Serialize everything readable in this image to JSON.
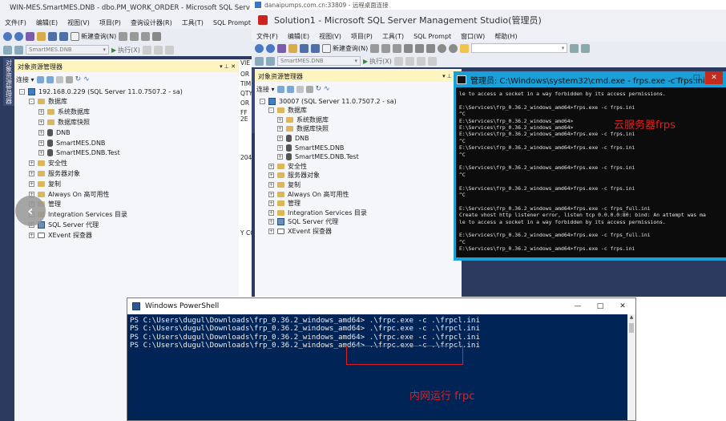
{
  "rdp_bar": {
    "title": "danaipumps.com.cn:33809 - 远程桌面连接"
  },
  "ssms_left": {
    "title": "WIN-MES.SmartMES.DNB - dbo.PM_WORK_ORDER - Microsoft SQL Server",
    "menu": [
      "文件(F)",
      "编辑(E)",
      "视图(V)",
      "项目(P)",
      "查询设计器(R)",
      "工具(T)",
      "SQL Prompt"
    ],
    "new_query": "新建查询(N)",
    "db_combo": "SmartMES.DNB",
    "execute": "执行(X)",
    "vertical_tab": "对象资源管理器",
    "explorer_title": "对象资源管理器",
    "connect": "连接",
    "tree": [
      {
        "label": "192.168.0.229 (SQL Server 11.0.7507.2 - sa)",
        "level": 0,
        "kind": "server",
        "exp": "-"
      },
      {
        "label": "数据库",
        "level": 1,
        "kind": "folder",
        "exp": "-"
      },
      {
        "label": "系统数据库",
        "level": 2,
        "kind": "folder",
        "exp": "+"
      },
      {
        "label": "数据库快照",
        "level": 2,
        "kind": "folder",
        "exp": "+"
      },
      {
        "label": "DNB",
        "level": 2,
        "kind": "db",
        "exp": "+"
      },
      {
        "label": "SmartMES.DNB",
        "level": 2,
        "kind": "db",
        "exp": "+"
      },
      {
        "label": "SmartMES.DNB.Test",
        "level": 2,
        "kind": "db",
        "exp": "+"
      },
      {
        "label": "安全性",
        "level": 1,
        "kind": "folder",
        "exp": "+"
      },
      {
        "label": "服务器对象",
        "level": 1,
        "kind": "folder",
        "exp": "+"
      },
      {
        "label": "复制",
        "level": 1,
        "kind": "folder",
        "exp": "+"
      },
      {
        "label": "Always On 高可用性",
        "level": 1,
        "kind": "folder",
        "exp": "+"
      },
      {
        "label": "管理",
        "level": 1,
        "kind": "folder",
        "exp": "+"
      },
      {
        "label": "Integration Services 目录",
        "level": 1,
        "kind": "folder",
        "exp": "+"
      },
      {
        "label": "SQL Server 代理",
        "level": 1,
        "kind": "agent",
        "exp": "+"
      },
      {
        "label": "XEvent 探查器",
        "level": 1,
        "kind": "xevent",
        "exp": "+"
      }
    ],
    "peek_text": [
      "VIE",
      "OR",
      "TIM",
      "QTY",
      "OR",
      "FF",
      "2E",
      "204",
      "Y CO"
    ]
  },
  "ssms_right": {
    "title": "Solution1 - Microsoft SQL Server Management Studio(管理员)",
    "menu": [
      "文件(F)",
      "编辑(E)",
      "视图(V)",
      "项目(P)",
      "工具(T)",
      "SQL Prompt",
      "窗口(W)",
      "帮助(H)"
    ],
    "new_query": "新建查询(N)",
    "db_combo": "SmartMES.DNB",
    "execute": "执行(X)",
    "vertical_tab": "对象资源管理器",
    "explorer_title": "对象资源管理器",
    "connect": "连接",
    "tree": [
      {
        "label": "30007 (SQL Server 11.0.7507.2 - sa)",
        "level": 0,
        "kind": "server",
        "exp": "-"
      },
      {
        "label": "数据库",
        "level": 1,
        "kind": "folder",
        "exp": "-"
      },
      {
        "label": "系统数据库",
        "level": 2,
        "kind": "folder",
        "exp": "+"
      },
      {
        "label": "数据库快照",
        "level": 2,
        "kind": "folder",
        "exp": "+"
      },
      {
        "label": "DNB",
        "level": 2,
        "kind": "db",
        "exp": "+"
      },
      {
        "label": "SmartMES.DNB",
        "level": 2,
        "kind": "db",
        "exp": "+"
      },
      {
        "label": "SmartMES.DNB.Test",
        "level": 2,
        "kind": "db",
        "exp": "+"
      },
      {
        "label": "安全性",
        "level": 1,
        "kind": "folder",
        "exp": "+"
      },
      {
        "label": "服务器对象",
        "level": 1,
        "kind": "folder",
        "exp": "+"
      },
      {
        "label": "复制",
        "level": 1,
        "kind": "folder",
        "exp": "+"
      },
      {
        "label": "Always On 高可用性",
        "level": 1,
        "kind": "folder",
        "exp": "+"
      },
      {
        "label": "管理",
        "level": 1,
        "kind": "folder",
        "exp": "+"
      },
      {
        "label": "Integration Services 目录",
        "level": 1,
        "kind": "folder",
        "exp": "+"
      },
      {
        "label": "SQL Server 代理",
        "level": 1,
        "kind": "agent",
        "exp": "+"
      },
      {
        "label": "XEvent 探查器",
        "level": 1,
        "kind": "xevent",
        "exp": "+"
      }
    ]
  },
  "cmd": {
    "title": "管理员: C:\\Windows\\system32\\cmd.exe - frps.exe  -c frps.ini",
    "lines": [
      "le to access a socket in a way forbidden by its access permissions.",
      "",
      "E:\\Services\\frp_0.36.2_windows_amd64>frps.exe -c frps.ini",
      "^C",
      "E:\\Services\\frp_0.36.2_windows_amd64>",
      "E:\\Services\\frp_0.36.2_windows_amd64>",
      "E:\\Services\\frp_0.36.2_windows_amd64>frps.exe -c frps.ini",
      "^C",
      "E:\\Services\\frp_0.36.2_windows_amd64>frps.exe -c frps.ini",
      "^C",
      "",
      "E:\\Services\\frp_0.36.2_windows_amd64>frps.exe -c frps.ini",
      "^C",
      "",
      "E:\\Services\\frp_0.36.2_windows_amd64>frps.exe -c frps.ini",
      "^C",
      "",
      "E:\\Services\\frp_0.36.2_windows_amd64>frps.exe -c frps_full.ini",
      "Create vhost http listener error, listen tcp 0.0.0.0:80: bind: An attempt was ma",
      "le to access a socket in a way forbidden by its access permissions.",
      "",
      "E:\\Services\\frp_0.36.2_windows_amd64>frps.exe -c frps_full.ini",
      "^C",
      "E:\\Services\\frp_0.36.2_windows_amd64>frps.exe -c frps.ini"
    ],
    "annotation": "云服务器frps"
  },
  "powershell": {
    "title": "Windows PowerShell",
    "lines": [
      "PS C:\\Users\\dugul\\Downloads\\frp_0.36.2_windows_amd64> .\\frpc.exe -c .\\frpcl.ini",
      "PS C:\\Users\\dugul\\Downloads\\frp_0.36.2_windows_amd64> .\\frpc.exe -c .\\frpcl.ini",
      "PS C:\\Users\\dugul\\Downloads\\frp_0.36.2_windows_amd64> .\\frpc.exe -c .\\frpcl.ini",
      "PS C:\\Users\\dugul\\Downloads\\frp_0.36.2_windows_amd64> .\\frpc.exe -c .\\frpcl.ini"
    ],
    "annotation": "内网运行 frpc"
  },
  "colors": {
    "ssms_bg": "#2d3a5f",
    "cmd_border": "#1a9fd6",
    "ps_bg": "#012456",
    "annotation_red": "#e02020"
  }
}
